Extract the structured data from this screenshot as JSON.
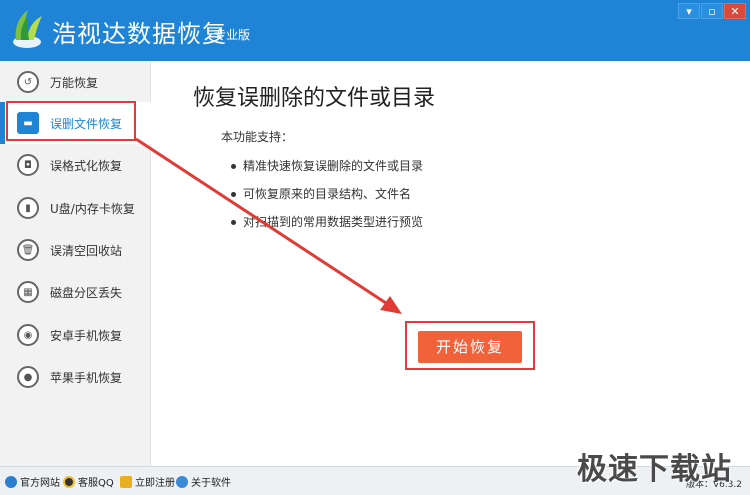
{
  "app": {
    "title": "浩视达数据恢复",
    "edition": "专业版",
    "window_buttons": [
      "▾",
      "▫",
      "✕"
    ]
  },
  "sidebar": {
    "items": [
      {
        "label": "万能恢复",
        "icon": "refresh-icon",
        "glyph": "↺"
      },
      {
        "label": "误删文件恢复",
        "icon": "folder-icon",
        "glyph": "▬",
        "active": true
      },
      {
        "label": "误格式化恢复",
        "icon": "disk-icon",
        "glyph": "◘"
      },
      {
        "label": "U盘/内存卡恢复",
        "icon": "usb-icon",
        "glyph": "▮"
      },
      {
        "label": "误清空回收站",
        "icon": "trash-icon",
        "glyph": "🗑"
      },
      {
        "label": "磁盘分区丢失",
        "icon": "partition-icon",
        "glyph": "▦"
      },
      {
        "label": "安卓手机恢复",
        "icon": "android-icon",
        "glyph": "◉"
      },
      {
        "label": "苹果手机恢复",
        "icon": "apple-icon",
        "glyph": "●"
      }
    ]
  },
  "main": {
    "title": "恢复误删除的文件或目录",
    "support_label": "本功能支持：",
    "features": [
      "精准快速恢复误删除的文件或目录",
      "可恢复原来的目录结构、文件名",
      "对扫描到的常用数据类型进行预览"
    ],
    "start_button": "开始恢复"
  },
  "statusbar": {
    "links": [
      {
        "label": "官方网站",
        "icon": "globe-icon"
      },
      {
        "label": "客服QQ",
        "icon": "qq-icon"
      },
      {
        "label": "立即注册",
        "icon": "key-icon"
      },
      {
        "label": "关于软件",
        "icon": "info-icon"
      }
    ],
    "version": "版本：V6.3.2"
  },
  "watermark": "极速下载站",
  "colors": {
    "accent": "#1f84d6",
    "start": "#f2623a",
    "highlight": "#e03b35"
  }
}
